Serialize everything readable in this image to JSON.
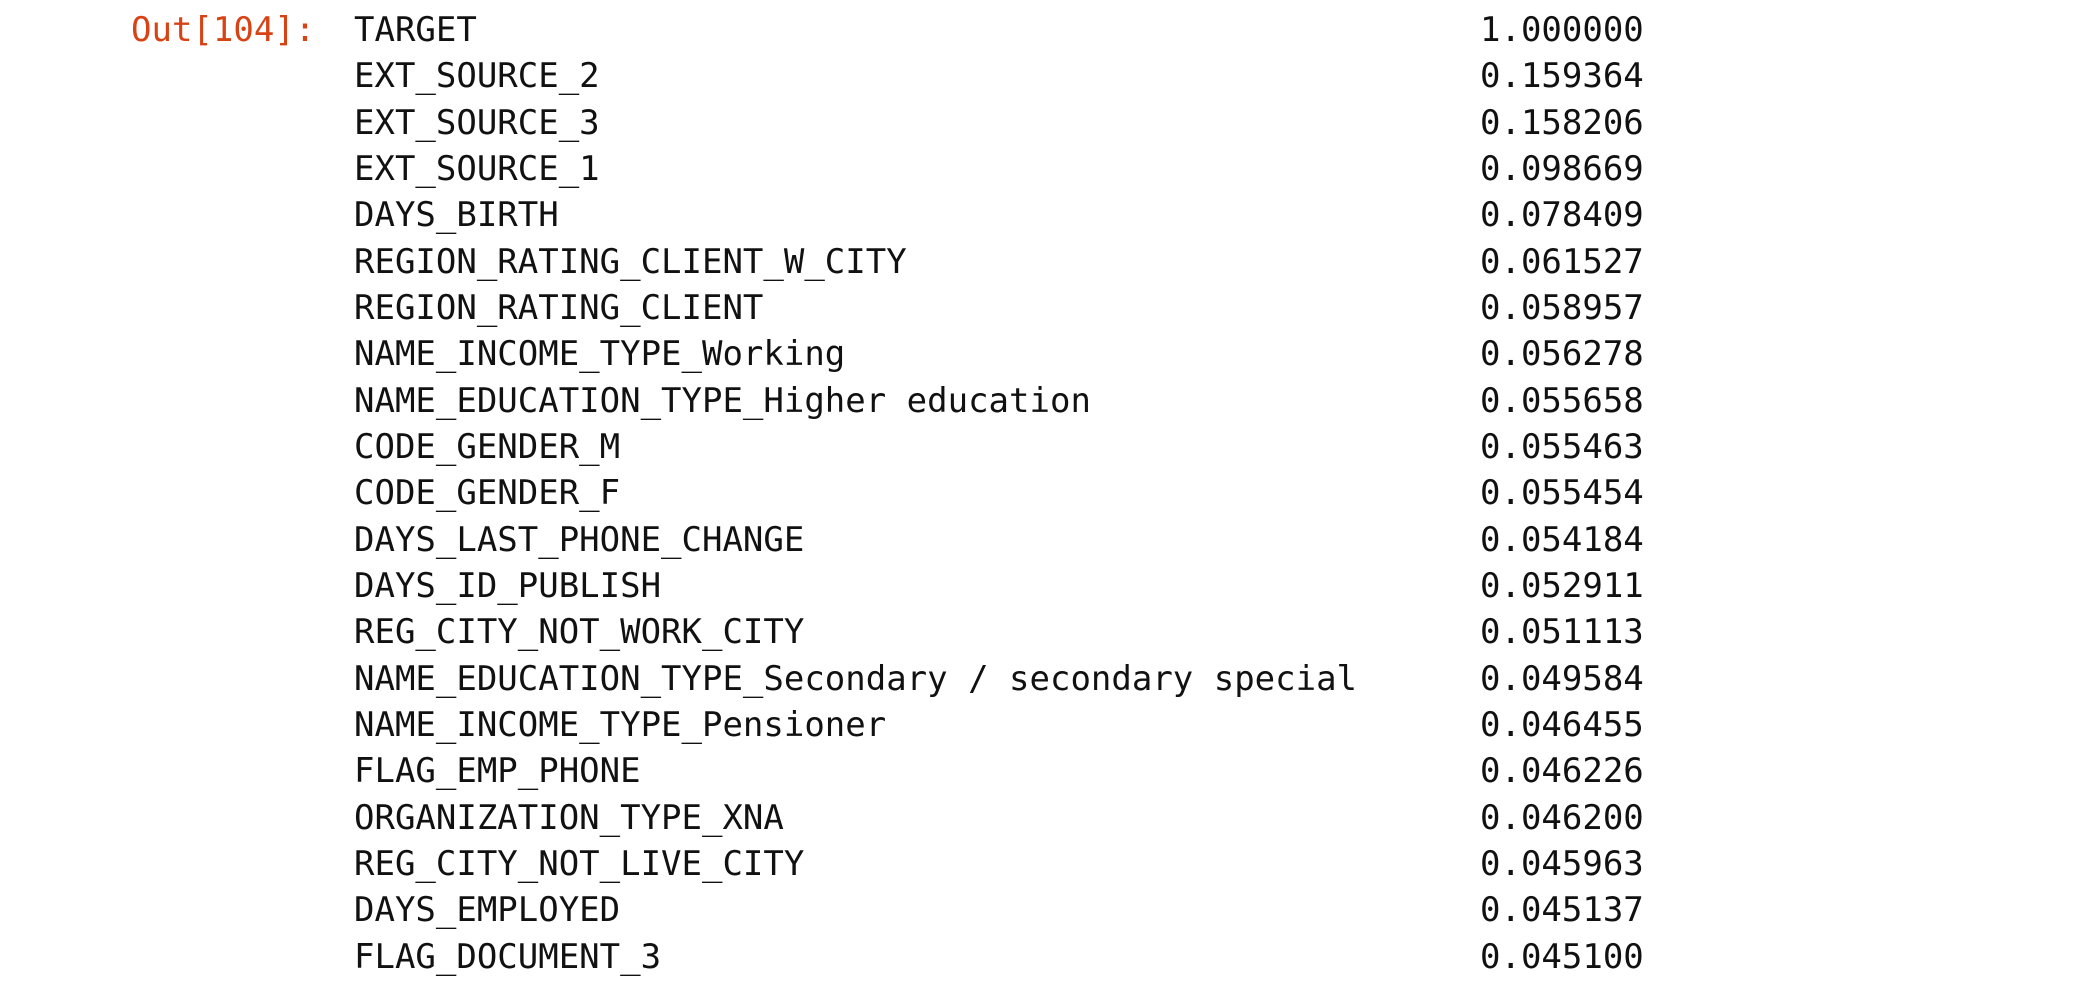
{
  "prompt": "Out[104]:",
  "rows": [
    {
      "name": "TARGET",
      "value": "1.000000"
    },
    {
      "name": "EXT_SOURCE_2",
      "value": "0.159364"
    },
    {
      "name": "EXT_SOURCE_3",
      "value": "0.158206"
    },
    {
      "name": "EXT_SOURCE_1",
      "value": "0.098669"
    },
    {
      "name": "DAYS_BIRTH",
      "value": "0.078409"
    },
    {
      "name": "REGION_RATING_CLIENT_W_CITY",
      "value": "0.061527"
    },
    {
      "name": "REGION_RATING_CLIENT",
      "value": "0.058957"
    },
    {
      "name": "NAME_INCOME_TYPE_Working",
      "value": "0.056278"
    },
    {
      "name": "NAME_EDUCATION_TYPE_Higher education",
      "value": "0.055658"
    },
    {
      "name": "CODE_GENDER_M",
      "value": "0.055463"
    },
    {
      "name": "CODE_GENDER_F",
      "value": "0.055454"
    },
    {
      "name": "DAYS_LAST_PHONE_CHANGE",
      "value": "0.054184"
    },
    {
      "name": "DAYS_ID_PUBLISH",
      "value": "0.052911"
    },
    {
      "name": "REG_CITY_NOT_WORK_CITY",
      "value": "0.051113"
    },
    {
      "name": "NAME_EDUCATION_TYPE_Secondary / secondary special",
      "value": "0.049584"
    },
    {
      "name": "NAME_INCOME_TYPE_Pensioner",
      "value": "0.046455"
    },
    {
      "name": "FLAG_EMP_PHONE",
      "value": "0.046226"
    },
    {
      "name": "ORGANIZATION_TYPE_XNA",
      "value": "0.046200"
    },
    {
      "name": "REG_CITY_NOT_LIVE_CITY",
      "value": "0.045963"
    },
    {
      "name": "DAYS_EMPLOYED",
      "value": "0.045137"
    },
    {
      "name": "FLAG_DOCUMENT_3",
      "value": "0.045100"
    }
  ],
  "colors": {
    "prompt": "#d84315",
    "text": "#111111",
    "background": "#ffffff"
  }
}
